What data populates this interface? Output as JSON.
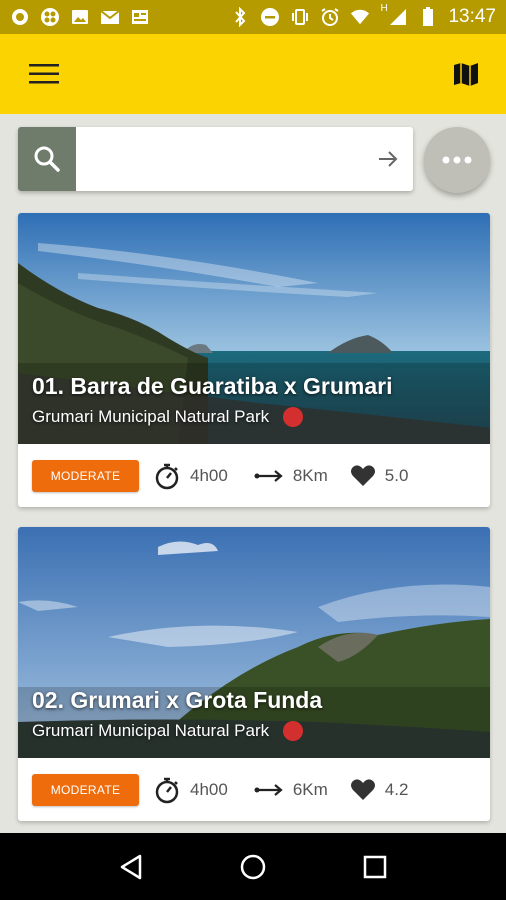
{
  "status_bar": {
    "time": "13:47",
    "network_letter": "H",
    "left_icons": [
      "whatsapp-icon",
      "cloverleaf-icon",
      "image-icon",
      "gmail-icon",
      "news-icon"
    ],
    "right_icons": [
      "bluetooth-icon",
      "dnd-icon",
      "vibrate-icon",
      "alarm-icon",
      "wifi-icon",
      "signal-icon",
      "battery-icon"
    ]
  },
  "app_bar": {
    "menu_icon": "hamburger-menu-icon",
    "map_icon": "map-icon",
    "background": "#fbd300"
  },
  "search": {
    "value": "",
    "placeholder": ""
  },
  "trails": [
    {
      "title": "01. Barra de Guaratiba x Grumari",
      "park": "Grumari Municipal Natural Park",
      "difficulty": "MODERATE",
      "duration": "4h00",
      "distance": "8Km",
      "rating": "5.0"
    },
    {
      "title": "02. Grumari x Grota Funda",
      "park": "Grumari Municipal Natural Park",
      "difficulty": "MODERATE",
      "duration": "4h00",
      "distance": "6Km",
      "rating": "4.2"
    }
  ],
  "colors": {
    "accent": "#fbd300",
    "badge": "#ee6c0c",
    "marker": "#d32f2f"
  }
}
